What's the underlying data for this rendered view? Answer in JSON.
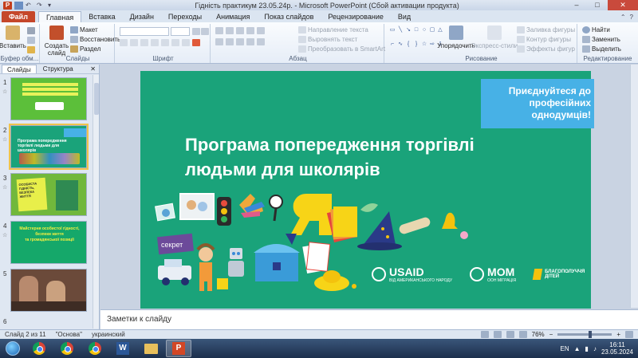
{
  "window": {
    "title": "Гідність практикум 23.05.24р. - Microsoft PowerPoint (Сбой активации продукта)",
    "minimize": "–",
    "maximize": "□",
    "close": "✕"
  },
  "ribbon_tabs": [
    {
      "label": "Файл"
    },
    {
      "label": "Главная"
    },
    {
      "label": "Вставка"
    },
    {
      "label": "Дизайн"
    },
    {
      "label": "Переходы"
    },
    {
      "label": "Анимация"
    },
    {
      "label": "Показ слайдов"
    },
    {
      "label": "Рецензирование"
    },
    {
      "label": "Вид"
    }
  ],
  "ribbon": {
    "clipboard": {
      "paste": "Вставить",
      "label": "Буфер обм..."
    },
    "slides": {
      "new_slide": "Создать слайд",
      "layout": "Макет",
      "reset": "Восстановить",
      "section": "Раздел",
      "label": "Слайды"
    },
    "font": {
      "label": "Шрифт"
    },
    "paragraph": {
      "text_direction": "Направление текста",
      "align_text": "Выровнять текст",
      "smartart": "Преобразовать в SmartArt",
      "label": "Абзац"
    },
    "drawing": {
      "arrange": "Упорядочить",
      "quick_styles": "Экспресс-стили",
      "shape_fill": "Заливка фигуры",
      "shape_outline": "Контур фигуры",
      "shape_effects": "Эффекты фигур",
      "label": "Рисование"
    },
    "editing": {
      "find": "Найти",
      "replace": "Заменить",
      "select": "Выделить",
      "label": "Редактирование"
    }
  },
  "left_panel": {
    "tab_slides": "Слайды",
    "tab_outline": "Структура",
    "close": "✕",
    "thumbnails": [
      {
        "num": "1",
        "star": "☆",
        "line1": "",
        "line2": ""
      },
      {
        "num": "2",
        "star": "☆",
        "line1": "Програма попередження",
        "line2": "торгівлі людьми для школярів"
      },
      {
        "num": "3",
        "star": "☆",
        "line1": "ОСОБИСТА ГІДНІСТЬ, БЕЗПЕКА",
        "line2": "ЖИТТЯ"
      },
      {
        "num": "4",
        "star": "☆",
        "line1": "Майстерня особистої гідності, безпеки життя",
        "line2": "та громадянської позиції"
      },
      {
        "num": "5",
        "star": "",
        "line1": "",
        "line2": ""
      }
    ]
  },
  "slide": {
    "banner": "Приєднуйтеся до професійних однодумців!",
    "title": "Програма попередження торгівлі людьми для школярів",
    "secret": "секрет",
    "logos": {
      "usaid": "USAID",
      "usaid_sub": "ВІД АМЕРИКАНСЬКОГО НАРОДУ",
      "mom": "МОМ",
      "mom_sub": "ООН МІГРАЦІЯ",
      "blago": "БЛАГОПОЛУЧЧЯ ДІТЕЙ"
    }
  },
  "notes": {
    "placeholder": "Заметки к слайду"
  },
  "status": {
    "slide": "Слайд 2 из 11",
    "theme": "\"Основа\"",
    "lang": "украинский",
    "zoom": "76%",
    "zoom_level": 0.6
  },
  "taskbar": {
    "lang": "EN",
    "time": "16:11",
    "date": "23.05.2024"
  },
  "colors": {
    "slide_bg": "#1aa37a",
    "banner": "#47b1e6",
    "ppt_accent": "#c5472a"
  }
}
